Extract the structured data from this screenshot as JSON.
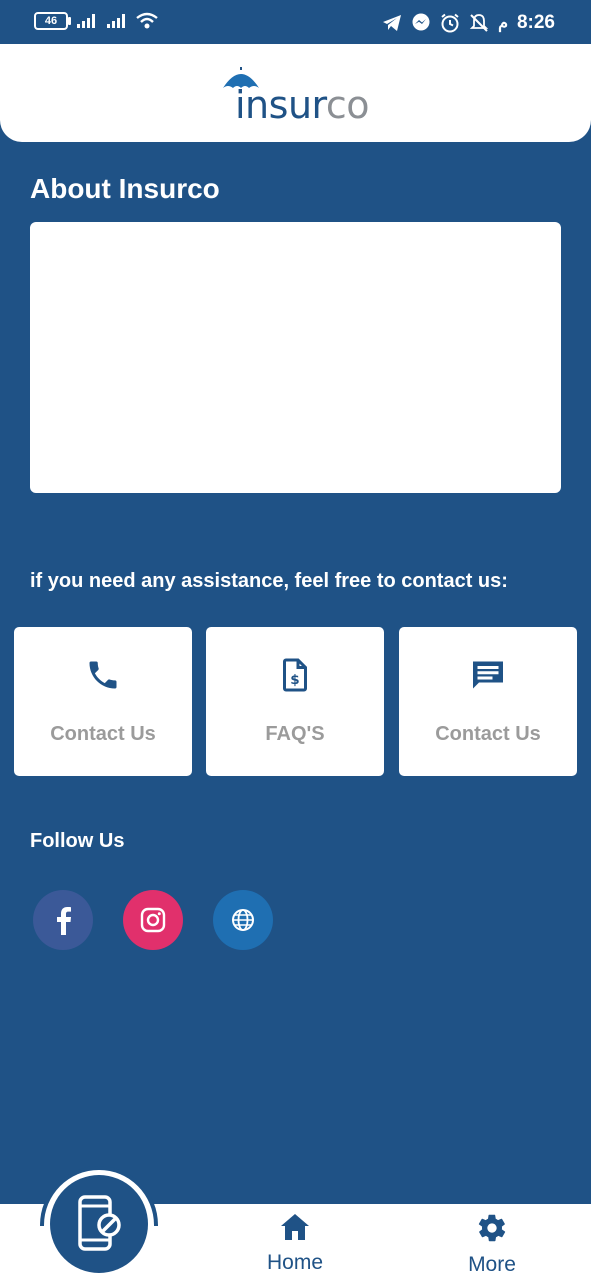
{
  "status_bar": {
    "battery": "46",
    "rtl_label": "م",
    "time": "8:26",
    "icons": [
      "battery-icon",
      "signal-icon",
      "signal-icon",
      "wifi-icon",
      "telegram-icon",
      "messenger-icon",
      "alarm-icon",
      "mute-icon"
    ]
  },
  "header": {
    "logo_part1": "insur",
    "logo_part2": "co"
  },
  "about": {
    "title": "About Insurco"
  },
  "assistance": {
    "text": "if you need any assistance, feel free to contact us:"
  },
  "cards": [
    {
      "label": "Contact Us",
      "icon": "phone-icon"
    },
    {
      "label": "FAQ'S",
      "icon": "invoice-dollar-icon"
    },
    {
      "label": "Contact Us",
      "icon": "chat-icon"
    }
  ],
  "follow": {
    "title": "Follow Us",
    "links": [
      {
        "icon": "facebook-icon",
        "color": "#3b5998"
      },
      {
        "icon": "instagram-icon",
        "color": "#e1306c"
      },
      {
        "icon": "globe-icon",
        "color": "#1f6fb2"
      }
    ]
  },
  "bottom_nav": {
    "fab_icon": "phone-blocked-icon",
    "items": [
      {
        "label": "Home",
        "icon": "home-icon"
      },
      {
        "label": "More",
        "icon": "gear-icon"
      }
    ]
  },
  "colors": {
    "primary": "#1f5286",
    "card_text": "#9b9b9b",
    "white": "#ffffff"
  }
}
